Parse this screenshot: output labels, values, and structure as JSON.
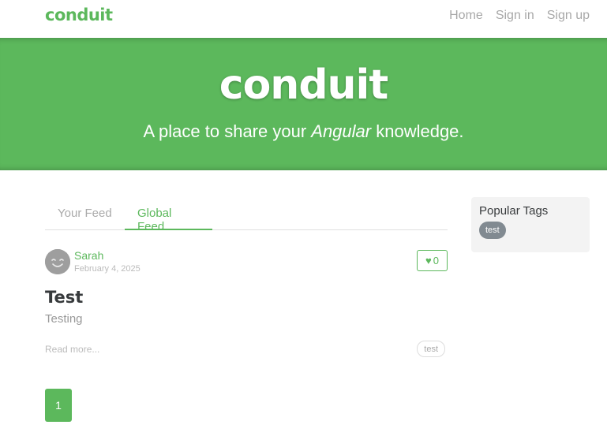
{
  "navbar": {
    "brand": "conduit",
    "links": [
      "Home",
      "Sign in",
      "Sign up"
    ]
  },
  "banner": {
    "title": "conduit",
    "tagline_before": "A place to share your ",
    "tagline_em": "Angular",
    "tagline_after": " knowledge."
  },
  "feed_tabs": {
    "your_feed": "Your Feed",
    "global_feed": "Global Feed",
    "active": "Global Feed"
  },
  "article": {
    "author": "Sarah",
    "date": "February 4, 2025",
    "likes": "0",
    "title": "Test",
    "description": "Testing",
    "read_more": "Read more...",
    "tag": "test"
  },
  "pagination": {
    "current_page": "1"
  },
  "sidebar": {
    "title": "Popular Tags",
    "tags": [
      "test"
    ]
  },
  "colors": {
    "brand": "#5cb85c",
    "tag_bg": "#818a91",
    "sidebar_bg": "#f3f3f3"
  },
  "icons": {
    "like": "heart-icon",
    "avatar": "smiley-avatar-icon"
  }
}
